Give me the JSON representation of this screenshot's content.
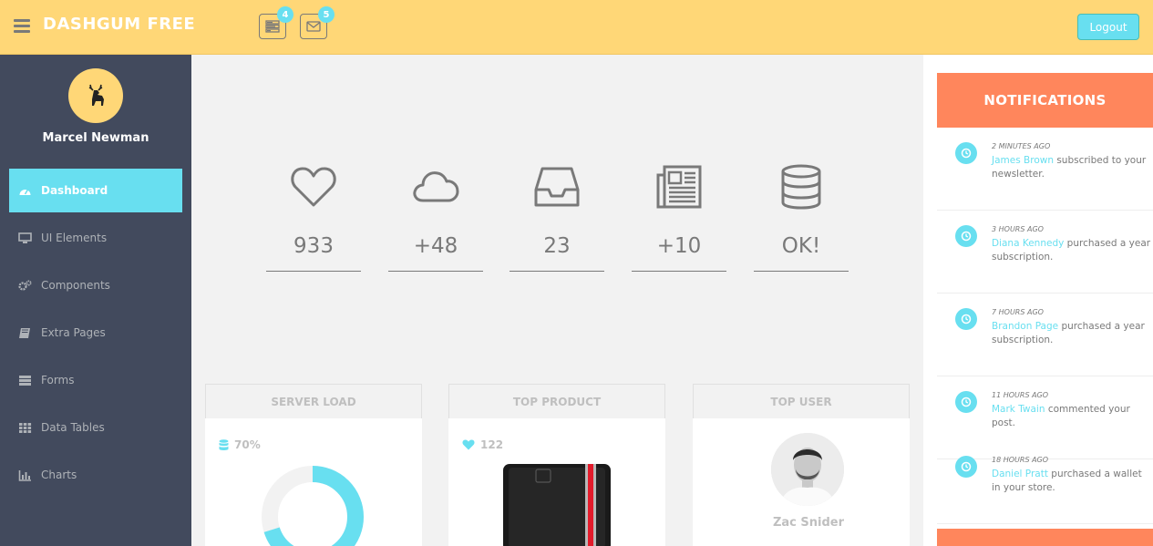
{
  "header": {
    "brand": "DASHGUM FREE",
    "tasks_badge": "4",
    "messages_badge": "5",
    "logout_label": "Logout"
  },
  "sidebar": {
    "user_name": "Marcel Newman",
    "items": [
      {
        "label": "Dashboard",
        "icon": "dashboard-icon",
        "active": true
      },
      {
        "label": "UI Elements",
        "icon": "desktop-icon"
      },
      {
        "label": "Components",
        "icon": "cogs-icon"
      },
      {
        "label": "Extra Pages",
        "icon": "book-icon"
      },
      {
        "label": "Forms",
        "icon": "tasks-icon"
      },
      {
        "label": "Data Tables",
        "icon": "table-icon"
      },
      {
        "label": "Charts",
        "icon": "bar-chart-icon"
      }
    ]
  },
  "stats": [
    {
      "icon": "heart-icon",
      "value": "933"
    },
    {
      "icon": "cloud-icon",
      "value": "+48"
    },
    {
      "icon": "inbox-icon",
      "value": "23"
    },
    {
      "icon": "newspaper-icon",
      "value": "+10"
    },
    {
      "icon": "database-icon",
      "value": "OK!"
    }
  ],
  "panels": {
    "server_load": {
      "title": "SERVER LOAD",
      "value": "70%",
      "load_fraction": 0.7
    },
    "top_product": {
      "title": "TOP PRODUCT",
      "value": "122"
    },
    "top_user": {
      "title": "TOP USER",
      "name": "Zac Snider"
    }
  },
  "notifications": {
    "title": "NOTIFICATIONS",
    "items": [
      {
        "time": "2 MINUTES AGO",
        "who": "James Brown",
        "text": " subscribed to your newsletter."
      },
      {
        "time": "3 HOURS AGO",
        "who": "Diana Kennedy",
        "text": " purchased a year subscription."
      },
      {
        "time": "7 HOURS AGO",
        "who": "Brandon Page",
        "text": " purchased a year subscription."
      },
      {
        "time": "11 HOURS AGO",
        "who": "Mark Twain",
        "text": " commented your post."
      },
      {
        "time": "18 HOURS AGO",
        "who": "Daniel Pratt",
        "text": " purchased a wallet in your store."
      }
    ]
  },
  "colors": {
    "header_bg": "#ffd777",
    "sidebar_bg": "#424a5d",
    "accent": "#68dff0",
    "notif_accent": "#ff865c"
  }
}
